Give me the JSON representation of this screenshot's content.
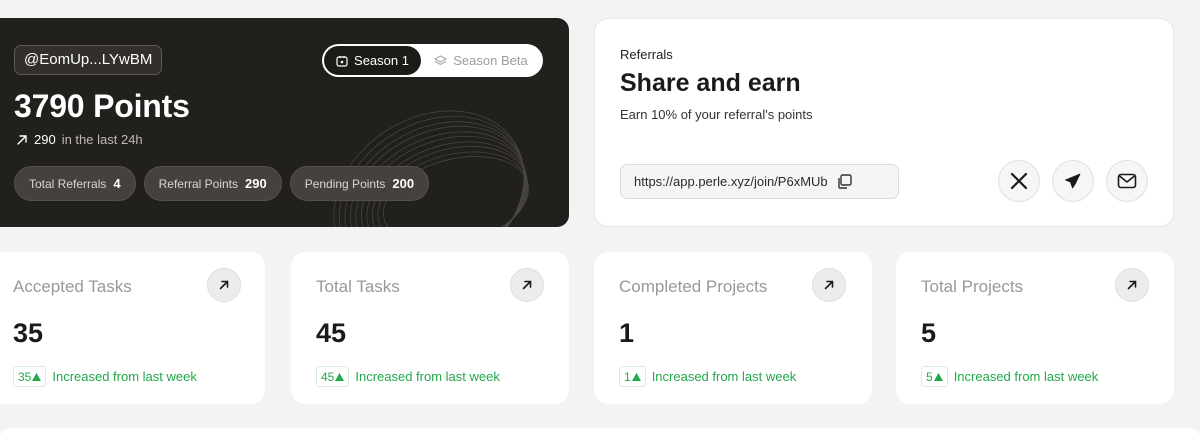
{
  "points_card": {
    "username": "@EomUp...LYwBM",
    "points": "3790 Points",
    "delta_value": "290",
    "delta_text": "in the last 24h",
    "stats": [
      {
        "label": "Total Referrals",
        "value": "4"
      },
      {
        "label": "Referral Points",
        "value": "290"
      },
      {
        "label": "Pending Points",
        "value": "200"
      }
    ],
    "seasons": [
      {
        "label": "Season 1",
        "icon": "calendar-icon",
        "active": true
      },
      {
        "label": "Season Beta",
        "icon": "layers-icon",
        "active": false
      }
    ]
  },
  "referrals": {
    "label": "Referrals",
    "title": "Share and earn",
    "subtitle": "Earn 10% of your referral's points",
    "link": "https://app.perle.xyz/join/P6xMUb",
    "share": [
      {
        "name": "x-icon"
      },
      {
        "name": "telegram-icon"
      },
      {
        "name": "mail-icon"
      }
    ]
  },
  "metrics": [
    {
      "title": "Accepted Tasks",
      "value": "35",
      "badge": "35",
      "trend": "Increased from last week"
    },
    {
      "title": "Total Tasks",
      "value": "45",
      "badge": "45",
      "trend": "Increased from last week"
    },
    {
      "title": "Completed Projects",
      "value": "1",
      "badge": "1",
      "trend": "Increased from last week"
    },
    {
      "title": "Total Projects",
      "value": "5",
      "badge": "5",
      "trend": "Increased from last week"
    }
  ],
  "colors": {
    "dark_card": "#22201c",
    "accent_green": "#21a84a",
    "page_bg": "#f3f3f3"
  }
}
